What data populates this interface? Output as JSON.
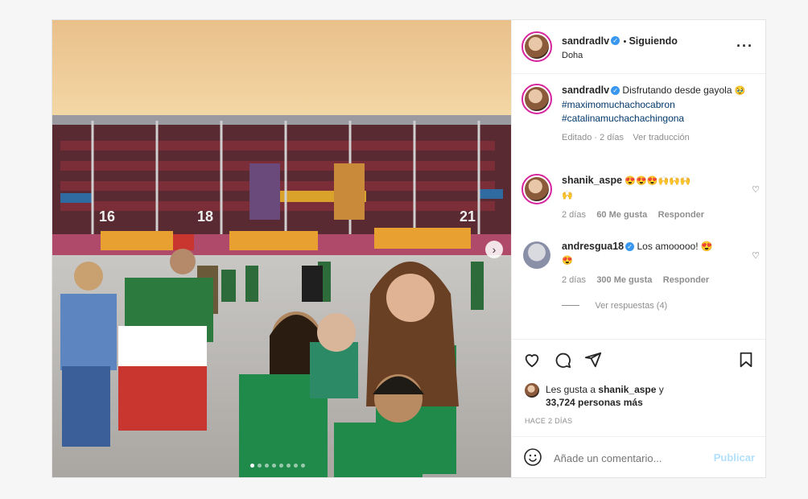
{
  "post": {
    "username": "sandradlv",
    "follow_status": "Siguiendo",
    "location": "Doha",
    "more_icon": "more-horizontal-icon"
  },
  "caption": {
    "username": "sandradlv",
    "text": "Disfrutando desde gayola",
    "emoji": "🥹",
    "hashtag1": "#maximomuchachocabron",
    "hashtag2": "#catalinamuchachachingona",
    "meta": "Editado · 2 días",
    "translate": "Ver traducción"
  },
  "comments": [
    {
      "username": "shanik_aspe",
      "text": "😍😍😍🙌🙌🙌",
      "text2": "🙌",
      "time": "2 días",
      "likes": "60 Me gusta",
      "reply": "Responder"
    },
    {
      "username": "andresgua18",
      "text": "Los amooooo! 😍",
      "text2": "😍",
      "time": "2 días",
      "likes": "300 Me gusta",
      "reply": "Responder",
      "view_replies": "Ver respuestas (4)"
    }
  ],
  "likes": {
    "line1": "Les gusta a",
    "user": "shanik_aspe",
    "conj": "y",
    "count": "33,724 personas más"
  },
  "timestamp": "HACE 2 DÍAS",
  "composer": {
    "placeholder": "Añade un comentario...",
    "publish": "Publicar"
  },
  "photo": {
    "stadium_numbers": [
      "16",
      "18",
      "21"
    ]
  },
  "colors": {
    "verified": "#3897f0",
    "publish": "#b2dffc",
    "ring": "#d6249f"
  }
}
